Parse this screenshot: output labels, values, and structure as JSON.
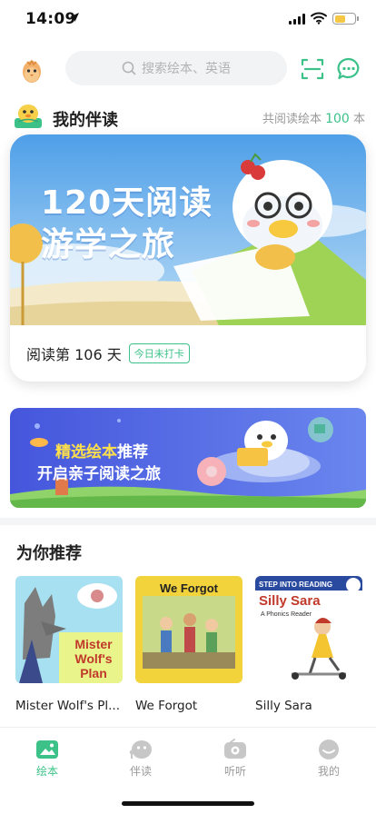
{
  "status_bar": {
    "time": "14:09"
  },
  "header": {
    "search_placeholder": "搜索绘本、英语"
  },
  "companion": {
    "title": "我的伴读",
    "read_count_prefix": "共阅读绘本",
    "read_count_value": "100",
    "read_count_unit": "本",
    "banner_line_1": "120天阅读",
    "banner_line_2": "游学之旅",
    "day_text": "阅读第 106 天",
    "checkin_status": "今日未打卡"
  },
  "promo": {
    "highlight": "精选绘本",
    "line_1_rest": "推荐",
    "line_2": "开启亲子阅读之旅"
  },
  "recommend": {
    "title": "为你推荐",
    "books": [
      {
        "title": "Mister Wolf's Pl...",
        "cover_text": [
          "Mister",
          "Wolf's",
          "Plan"
        ]
      },
      {
        "title": "We Forgot",
        "cover_text": "We Forgot"
      },
      {
        "title": "Silly Sara",
        "cover_text": [
          "STEP INTO READING",
          "Silly Sara",
          "A Phonics Reader"
        ]
      }
    ]
  },
  "tabs": [
    {
      "label": "绘本",
      "icon": "picture-book-icon",
      "active": true
    },
    {
      "label": "伴读",
      "icon": "companion-icon",
      "active": false
    },
    {
      "label": "听听",
      "icon": "radio-icon",
      "active": false
    },
    {
      "label": "我的",
      "icon": "profile-icon",
      "active": false
    }
  ],
  "colors": {
    "accent": "#3cc289",
    "banner_sky": "#5aa9ec",
    "promo_bg": "#4b5fe0"
  }
}
